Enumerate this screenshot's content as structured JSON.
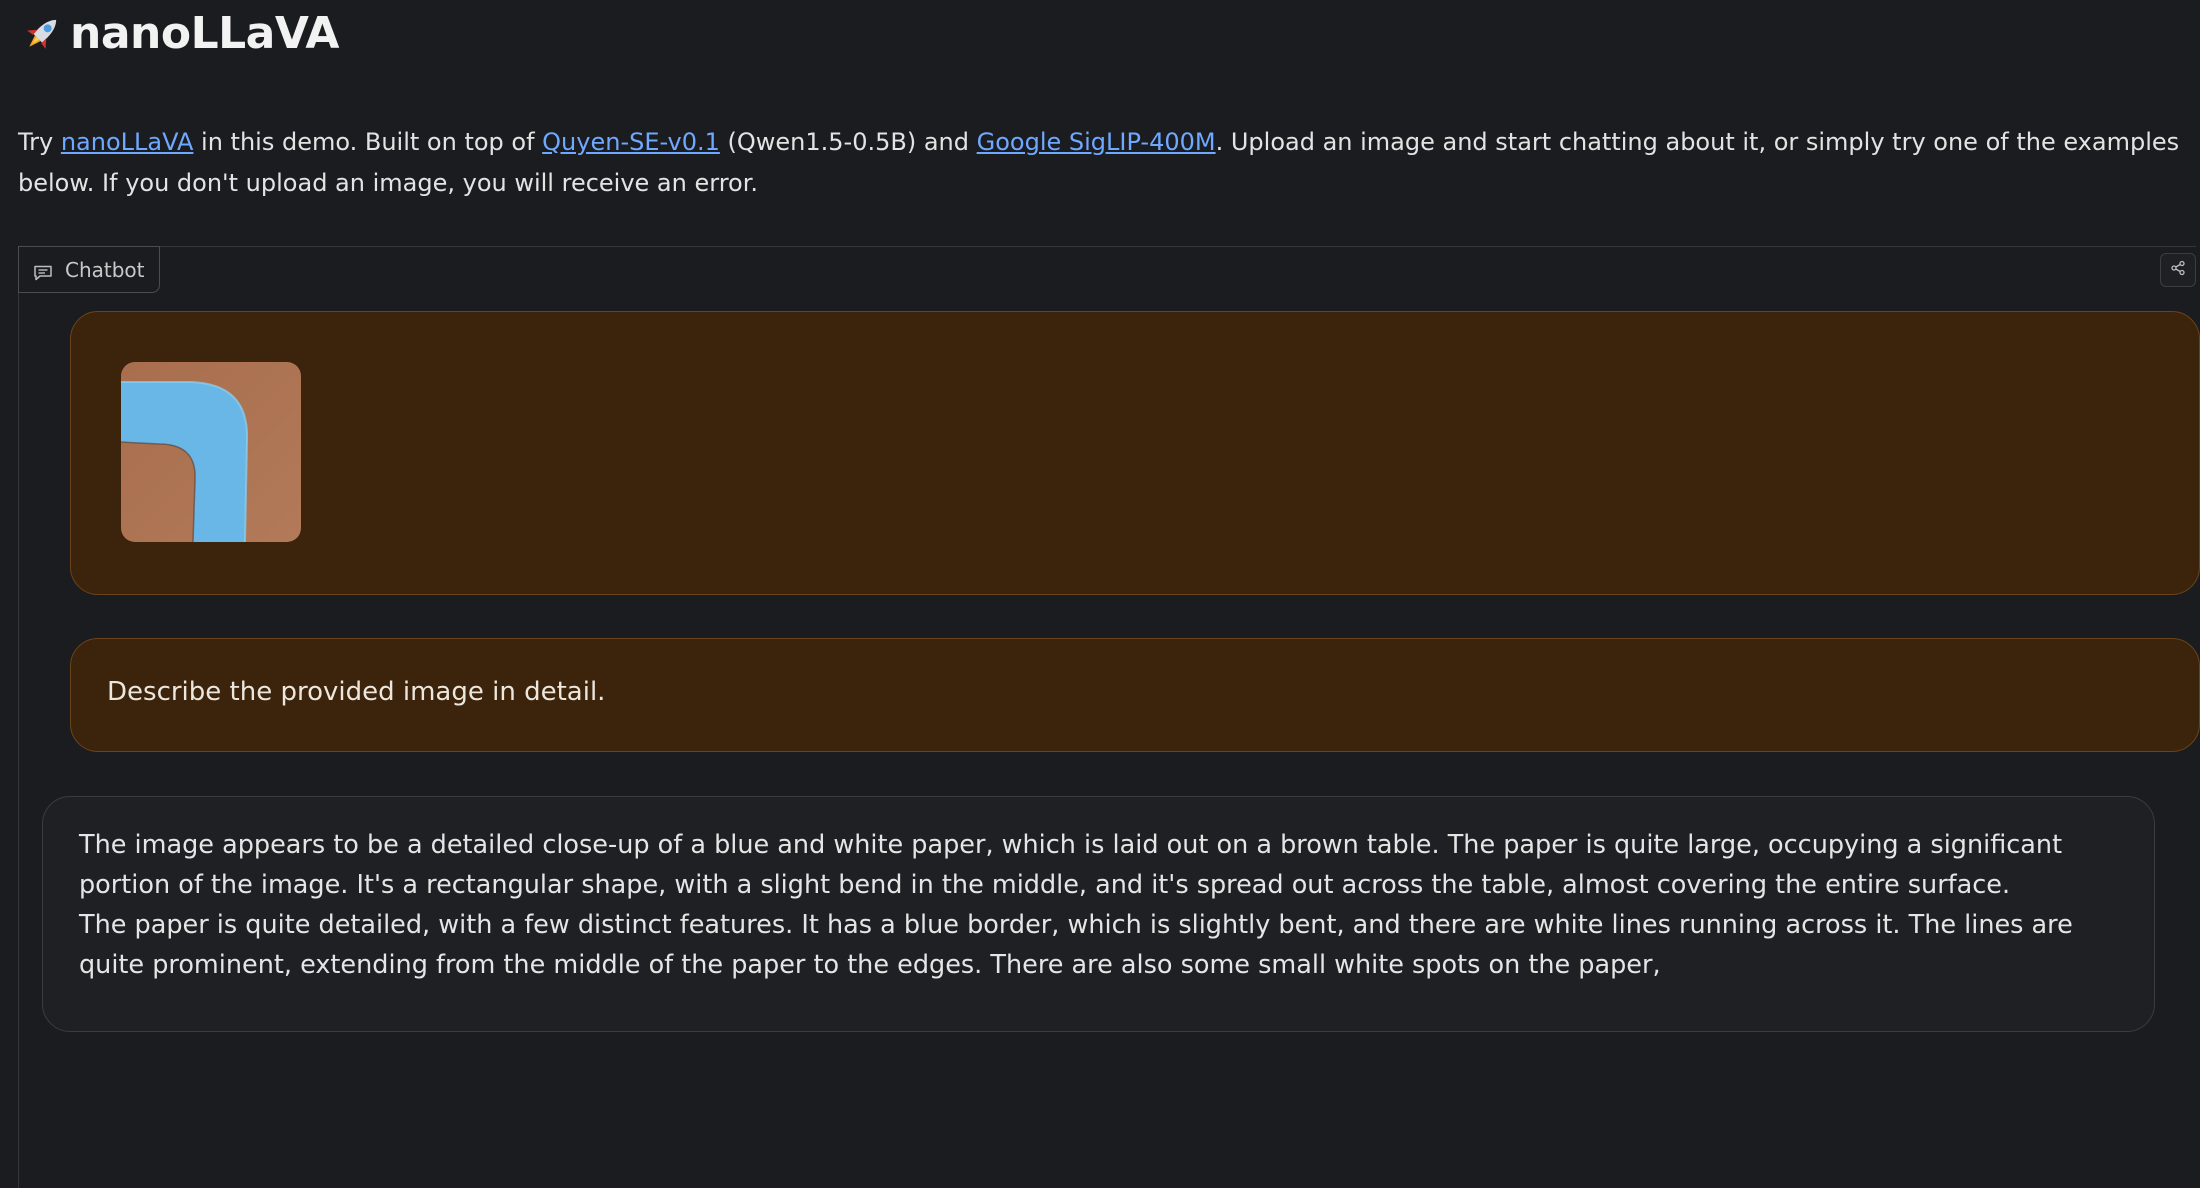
{
  "app": {
    "title": "nanoLLaVA",
    "title_icon": "rocket-icon"
  },
  "intro": {
    "t1": "Try ",
    "link1": "nanoLLaVA",
    "t2": " in this demo. Built on top of ",
    "link2": "Quyen-SE-v0.1",
    "t3": " (Qwen1.5-0.5B) and ",
    "link3": "Google SigLIP-400M",
    "t4": ". Upload an image and start chatting about it, or simply try one of the examples below. If you don't upload an image, you will receive an error."
  },
  "chat": {
    "label": "Chatbot",
    "label_icon": "chat-icon",
    "share_icon": "share-icon",
    "messages": [
      {
        "role": "user",
        "type": "image",
        "description_icon": "image-thumbnail"
      },
      {
        "role": "user",
        "type": "text",
        "text": "Describe the provided image in detail."
      },
      {
        "role": "assistant",
        "type": "text",
        "paragraphs": [
          "The image appears to be a detailed close-up of a blue and white paper, which is laid out on a brown table. The paper is quite large, occupying a significant portion of the image. It's a rectangular shape, with a slight bend in the middle, and it's spread out across the table, almost covering the entire surface.",
          "The paper is quite detailed, with a few distinct features. It has a blue border, which is slightly bent, and there are white lines running across it. The lines are quite prominent, extending from the middle of the paper to the edges. There are also some small white spots on the paper,"
        ]
      }
    ]
  },
  "colors": {
    "background": "#1b1c1f",
    "link": "#6fa8ff",
    "user_bubble": "#3c230b",
    "user_bubble_border": "#6a4418",
    "bot_bubble": "#1f2023"
  }
}
